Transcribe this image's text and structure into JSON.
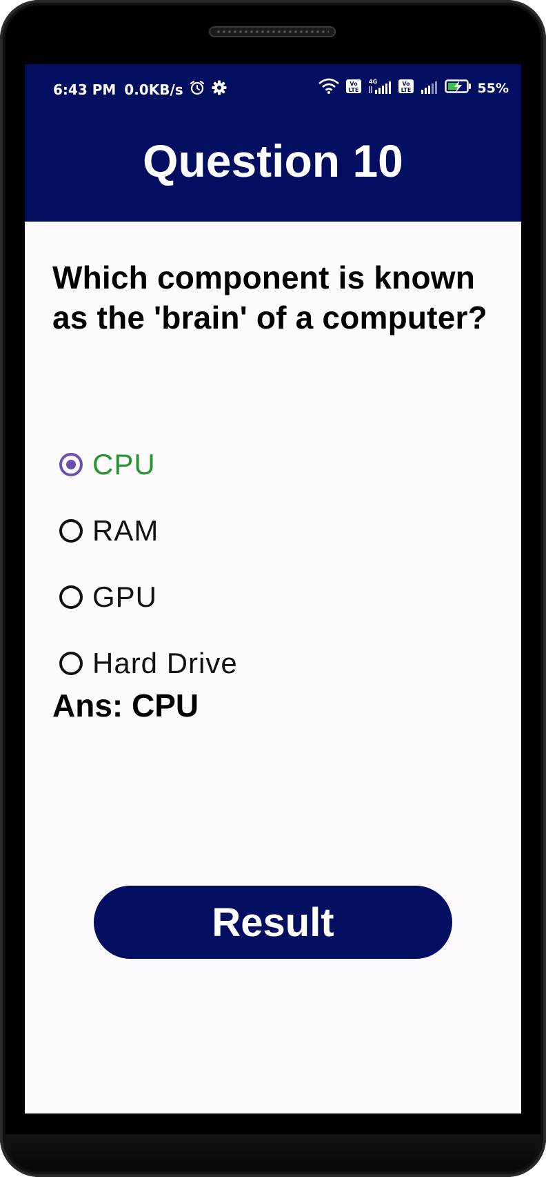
{
  "status_bar": {
    "time": "6:43 PM",
    "net_speed": "0.0KB/s",
    "battery": "55%",
    "network_label": "4G",
    "volte_label": "Vo LTE",
    "icons": [
      "alarm-icon",
      "gear-icon",
      "wifi-icon",
      "volte-icon",
      "signal-icon",
      "battery-charging-icon"
    ]
  },
  "header": {
    "title": "Question 10",
    "background": "#020f61"
  },
  "question": {
    "text": "Which component is known as the 'brain' of a computer?"
  },
  "options": [
    {
      "label": "CPU",
      "selected": true,
      "correct": true
    },
    {
      "label": "RAM",
      "selected": false,
      "correct": false
    },
    {
      "label": "GPU",
      "selected": false,
      "correct": false
    },
    {
      "label": "Hard Drive",
      "selected": false,
      "correct": false
    }
  ],
  "answer": {
    "text": "Ans: CPU"
  },
  "result_button": {
    "label": "Result"
  },
  "colors": {
    "accent": "#020f61",
    "radio_selected": "#6c4fb0",
    "correct_text": "#25962d"
  }
}
